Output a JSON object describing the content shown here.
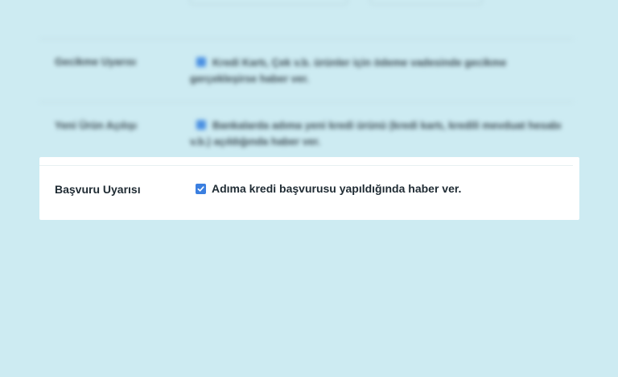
{
  "rows": [
    {
      "label": "Gecikme Uyarısı",
      "checked": true,
      "description": "Kredi Kartı, Çek v.b. ürünler için ödeme vadesinde gecikme gerçekleşirse haber ver."
    },
    {
      "label": "Yeni Ürün Açılışı",
      "checked": true,
      "description": "Bankalarda adıma yeni kredi ürünü (kredi kartı, kredili mevduat hesabı v.b.) açıldığında haber ver."
    }
  ],
  "focused_row": {
    "label": "Başvuru Uyarısı",
    "checked": true,
    "description": "Adıma kredi başvurusu yapıldığında haber ver."
  },
  "colors": {
    "background": "#cdebf2",
    "card": "#ffffff",
    "checkbox": "#3b7fe0",
    "text": "#1f2b33"
  }
}
